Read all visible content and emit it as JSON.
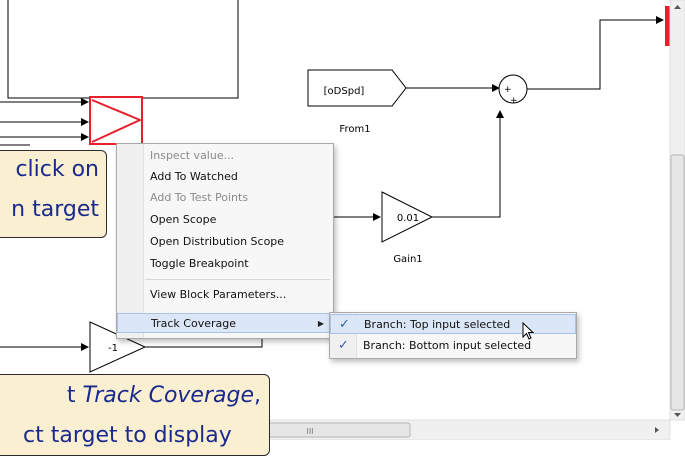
{
  "blocks": {
    "from_label": "[oDSpd]",
    "from_name": "From1",
    "gain_value": "0.01",
    "gain_name": "Gain1",
    "neg_gain_value": "-1",
    "sum_top_sign": "+",
    "sum_bottom_sign": "+"
  },
  "callouts": {
    "top_line1": "click on",
    "top_line2": "n target",
    "bottom_line1_prefix": "t ",
    "bottom_line1_italic": "Track Coverage",
    "bottom_line1_suffix": ",",
    "bottom_line2": "ct target to display"
  },
  "context_menu": {
    "items": [
      {
        "label": "Inspect value...",
        "enabled": false
      },
      {
        "label": "Add To Watched",
        "enabled": true
      },
      {
        "label": "Add To Test Points",
        "enabled": false
      },
      {
        "label": "Open Scope",
        "enabled": true
      },
      {
        "label": "Open Distribution Scope",
        "enabled": true
      },
      {
        "label": "Toggle Breakpoint",
        "enabled": true
      },
      {
        "label": "View Block Parameters...",
        "enabled": true
      },
      {
        "label": "Track Coverage",
        "enabled": true,
        "highlighted": true,
        "has_submenu": true
      }
    ]
  },
  "submenu": {
    "items": [
      {
        "label": "Branch: Top input selected",
        "checked": true,
        "highlighted": true
      },
      {
        "label": "Branch: Bottom input selected",
        "checked": true,
        "highlighted": false
      }
    ]
  },
  "scrollbar": {
    "thumb_label": "III"
  },
  "colors": {
    "selected_block": "#e8202a",
    "callout_bg": "#fbefd2",
    "callout_text": "#1a2a8c",
    "check": "#2a5fb0"
  }
}
